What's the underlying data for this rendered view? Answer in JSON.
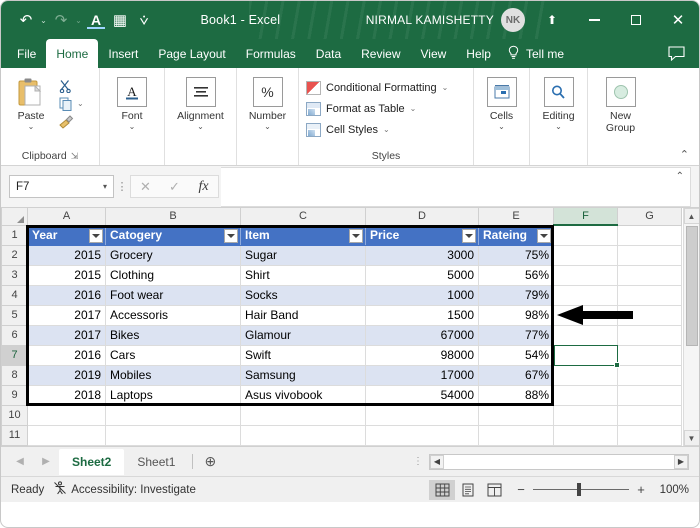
{
  "titlebar": {
    "quick_access": [
      {
        "name": "undo",
        "glyph": "↶"
      },
      {
        "name": "redo",
        "glyph": "↷"
      },
      {
        "name": "font-color",
        "glyph": "A"
      },
      {
        "name": "borders",
        "glyph": "▦"
      },
      {
        "name": "customize",
        "glyph": "⩒"
      }
    ],
    "doc_title": "Book1  -  Excel",
    "account_name": "NIRMAL KAMISHETTY",
    "avatar_initials": "NK",
    "ribbon_display_options": "⬆",
    "minimize": "—",
    "maximize": "▢",
    "close": "✕"
  },
  "ribbon_tabs": [
    {
      "label": "File",
      "active": false
    },
    {
      "label": "Home",
      "active": true
    },
    {
      "label": "Insert",
      "active": false
    },
    {
      "label": "Page Layout",
      "active": false
    },
    {
      "label": "Formulas",
      "active": false
    },
    {
      "label": "Data",
      "active": false
    },
    {
      "label": "Review",
      "active": false
    },
    {
      "label": "View",
      "active": false
    },
    {
      "label": "Help",
      "active": false
    }
  ],
  "tell_me": {
    "label": "Tell me",
    "icon": "💡"
  },
  "comment_icon": "🗩",
  "ribbon": {
    "clipboard": {
      "group_label": "Clipboard",
      "paste_label": "Paste",
      "paste_caret": "⌄",
      "cut_label": "Cut",
      "copy_label": "Copy",
      "copy_caret": "⌄",
      "format_painter_label": "Format Painter",
      "dialog_launcher": "⇲"
    },
    "font": {
      "label": "Font",
      "caret": "⌄",
      "glyph": "A"
    },
    "alignment": {
      "label": "Alignment",
      "caret": "⌄",
      "glyph": "≡"
    },
    "number": {
      "label": "Number",
      "caret": "⌄",
      "glyph": "%"
    },
    "styles": {
      "group_label": "Styles",
      "items": [
        {
          "label": "Conditional Formatting",
          "caret": "⌄"
        },
        {
          "label": "Format as Table",
          "caret": "⌄"
        },
        {
          "label": "Cell Styles",
          "caret": "⌄"
        }
      ]
    },
    "cells": {
      "label": "Cells",
      "caret": "⌄",
      "glyph": "▦"
    },
    "editing": {
      "label": "Editing",
      "caret": "⌄",
      "glyph": "🔎"
    },
    "new_group": {
      "label": "New",
      "label2": "Group",
      "caret": "⌄",
      "glyph": "◉"
    },
    "collapse_icon": "⌃"
  },
  "formula_bar": {
    "name_box_value": "F7",
    "name_box_caret": "▾",
    "grip": "⋮",
    "cancel_icon": "✕",
    "enter_icon": "✓",
    "function_icon": "fx",
    "formula_value": "",
    "expand_icon": "⌃"
  },
  "grid": {
    "column_headers": [
      "A",
      "B",
      "C",
      "D",
      "E",
      "F",
      "G"
    ],
    "selected_column": "F",
    "selected_row": "7",
    "row_headers": [
      "1",
      "2",
      "3",
      "4",
      "5",
      "6",
      "7",
      "8",
      "9",
      "10",
      "11"
    ],
    "table_headers": [
      "Year",
      "Catogery",
      "Item",
      "Price",
      "Rateing"
    ],
    "rows": [
      {
        "row": "2",
        "year": "2015",
        "category": "Grocery",
        "item": "Sugar",
        "price": "3000",
        "rating": "75%",
        "banded": true
      },
      {
        "row": "3",
        "year": "2015",
        "category": "Clothing",
        "item": "Shirt",
        "price": "5000",
        "rating": "56%",
        "banded": false
      },
      {
        "row": "4",
        "year": "2016",
        "category": "Foot wear",
        "item": "Socks",
        "price": "1000",
        "rating": "79%",
        "banded": true
      },
      {
        "row": "5",
        "year": "2017",
        "category": "Accessoris",
        "item": "Hair Band",
        "price": "1500",
        "rating": "98%",
        "banded": false
      },
      {
        "row": "6",
        "year": "2017",
        "category": "Bikes",
        "item": "Glamour",
        "price": "67000",
        "rating": "77%",
        "banded": true
      },
      {
        "row": "7",
        "year": "2016",
        "category": "Cars",
        "item": "Swift",
        "price": "98000",
        "rating": "54%",
        "banded": false
      },
      {
        "row": "8",
        "year": "2019",
        "category": "Mobiles",
        "item": "Samsung",
        "price": "17000",
        "rating": "67%",
        "banded": true
      },
      {
        "row": "9",
        "year": "2018",
        "category": "Laptops",
        "item": "Asus vivobook",
        "price": "54000",
        "rating": "88%",
        "banded": false
      }
    ],
    "empty_rows": [
      "10",
      "11"
    ],
    "header_fill_color": "#4472C4",
    "band_fill_color": "#DCE3F2",
    "selection_color": "#1D6B42",
    "scroll_up_icon": "▲",
    "scroll_down_icon": "▼"
  },
  "annotation": {
    "type": "arrow",
    "points_to_row": "5",
    "color": "#000000"
  },
  "sheet_bar": {
    "prev_icon": "◀",
    "next_icon": "▶",
    "tabs": [
      {
        "label": "Sheet2",
        "active": true
      },
      {
        "label": "Sheet1",
        "active": false
      }
    ],
    "add_sheet_icon": "⊕",
    "grip": "⋮",
    "hscroll_left": "◀",
    "hscroll_right": "▶"
  },
  "status_bar": {
    "status_text": "Ready",
    "accessibility_text": "Accessibility: Investigate",
    "accessibility_icon": "♿",
    "view_normal": "▦",
    "view_page_layout": "▤",
    "view_page_break": "◫",
    "zoom_out": "−",
    "zoom_in": "+",
    "zoom_level": "100%"
  }
}
